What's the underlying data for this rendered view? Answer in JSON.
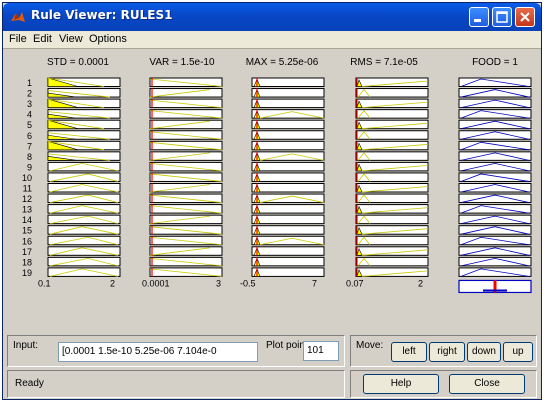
{
  "window": {
    "title": "Rule Viewer: RULES1"
  },
  "menu": [
    "File",
    "Edit",
    "View",
    "Options"
  ],
  "columns": [
    {
      "header": "STD = 0.0001",
      "range_min": "0.1",
      "range_max": "2"
    },
    {
      "header": "VAR = 1.5e-10",
      "range_min": "0.0001",
      "range_max": "3"
    },
    {
      "header": "MAX = 5.25e-06",
      "range_min": "-0.5",
      "range_max": "7"
    },
    {
      "header": "RMS = 7.1e-05",
      "range_min": "0.07",
      "range_max": "2"
    },
    {
      "header": "FOOD = 1",
      "range_min": "",
      "range_max": ""
    }
  ],
  "rule_numbers": [
    "1",
    "2",
    "3",
    "4",
    "5",
    "6",
    "7",
    "8",
    "9",
    "10",
    "11",
    "12",
    "13",
    "14",
    "15",
    "16",
    "17",
    "18",
    "19"
  ],
  "input": {
    "label": "Input:",
    "value": "[0.0001 1.5e-10 5.25e-06 7.104e-0"
  },
  "plot_points": {
    "label": "Plot points:",
    "value": "101"
  },
  "move": {
    "label": "Move:",
    "buttons": [
      "left",
      "right",
      "down",
      "up"
    ]
  },
  "status": "Ready",
  "help_label": "Help",
  "close_label": "Close",
  "colors": {
    "title_bar": "#0a5de8",
    "fill": "#ffff00",
    "mf_line": "#c8c800",
    "out_line": "#0000c0",
    "cursor": "#ff0000"
  }
}
